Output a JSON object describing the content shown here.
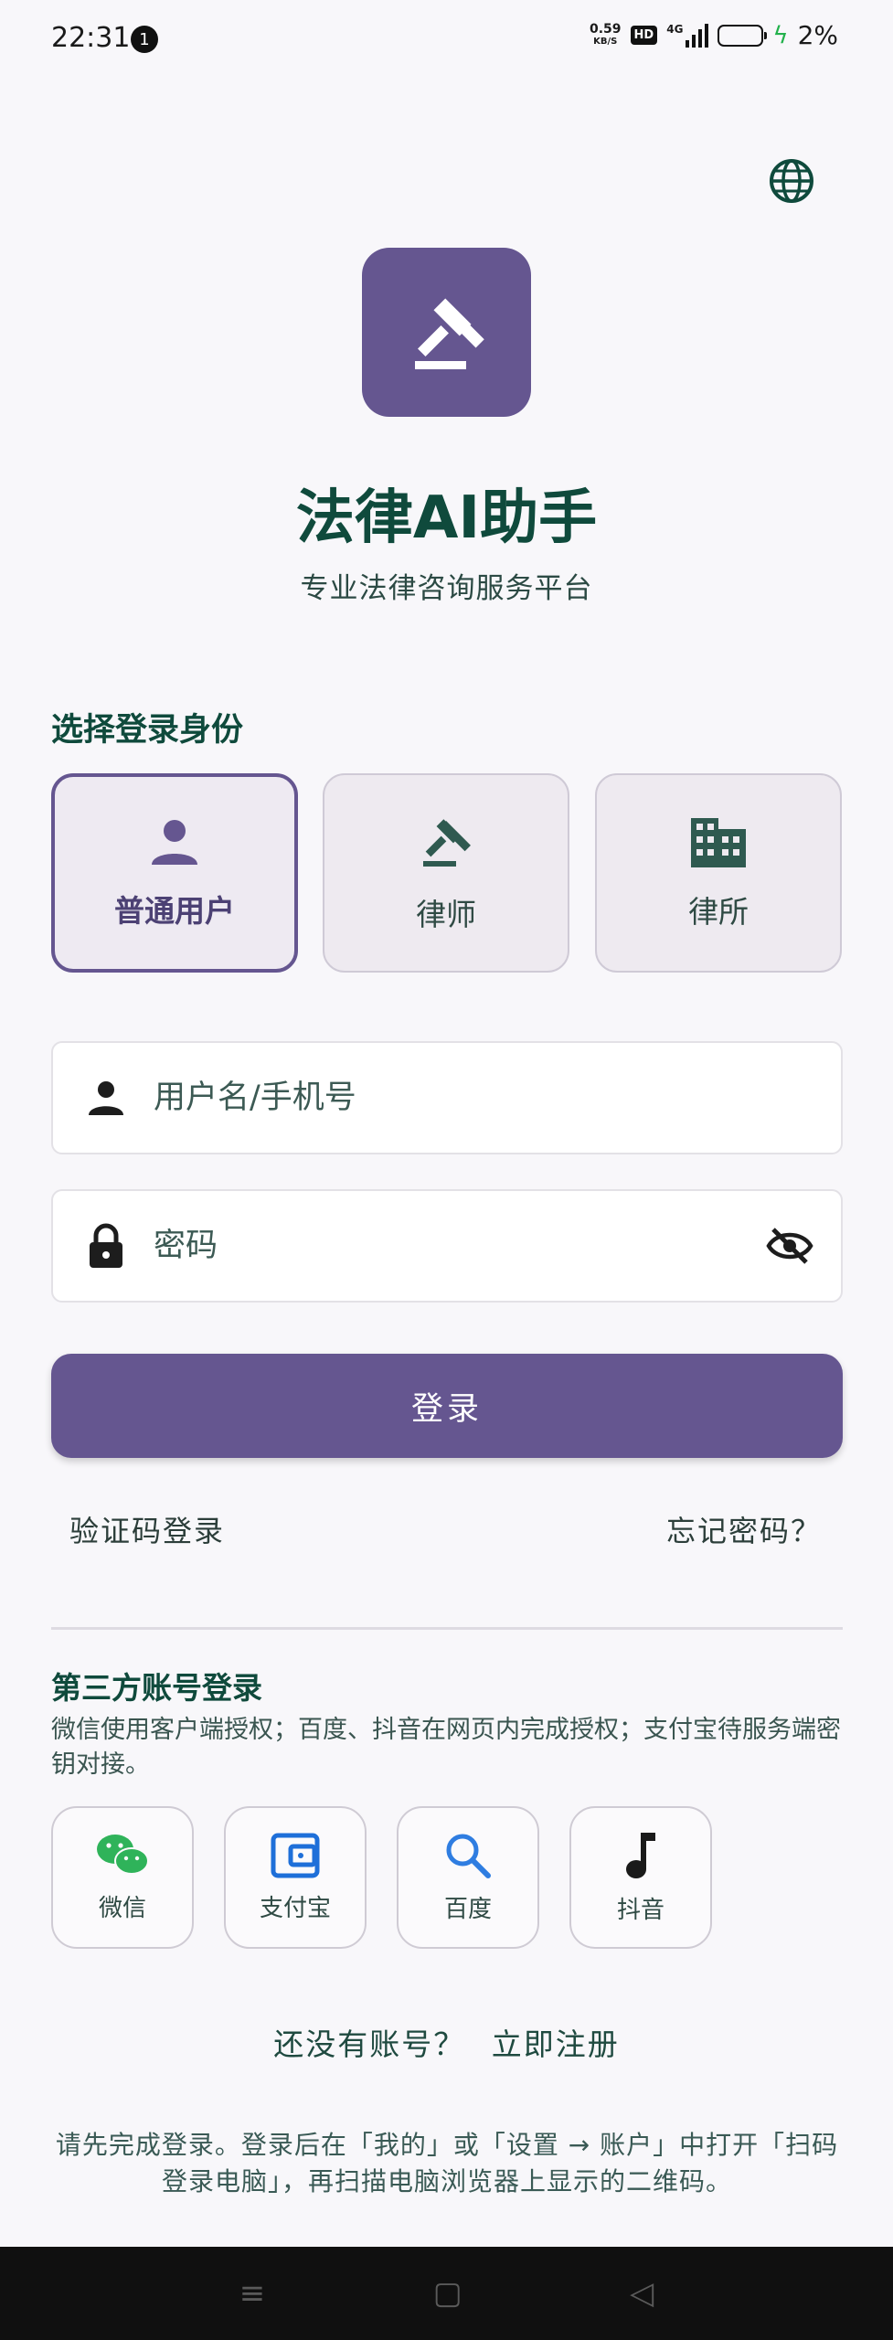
{
  "status_bar": {
    "time": "22:31",
    "notification_count": "1",
    "net_speed_value": "0.59",
    "net_speed_unit": "KB/S",
    "hd_label": "HD",
    "network_label": "4G",
    "battery_percent": "2%"
  },
  "app": {
    "title": "法律AI助手",
    "subtitle": "专业法律咨询服务平台",
    "accent_color": "#655690",
    "title_color": "#0f4a3c"
  },
  "role_section": {
    "label": "选择登录身份",
    "roles": [
      {
        "label": "普通用户",
        "icon": "person-icon",
        "selected": true
      },
      {
        "label": "律师",
        "icon": "gavel-icon",
        "selected": false
      },
      {
        "label": "律所",
        "icon": "building-icon",
        "selected": false
      }
    ]
  },
  "form": {
    "username_placeholder": "用户名/手机号",
    "password_placeholder": "密码",
    "login_label": "登录",
    "sms_login_label": "验证码登录",
    "forgot_label": "忘记密码？"
  },
  "third_party": {
    "title": "第三方账号登录",
    "description": "微信使用客户端授权；百度、抖音在网页内完成授权；支付宝待服务端密钥对接。",
    "providers": [
      {
        "label": "微信",
        "icon": "wechat-icon"
      },
      {
        "label": "支付宝",
        "icon": "alipay-icon"
      },
      {
        "label": "百度",
        "icon": "search-icon"
      },
      {
        "label": "抖音",
        "icon": "music-note-icon"
      }
    ]
  },
  "register": {
    "prompt": "还没有账号？",
    "link": "立即注册"
  },
  "footer_hint": "请先完成登录。登录后在「我的」或「设置 → 账户」中打开「扫码登录电脑」，再扫描电脑浏览器上显示的二维码。",
  "nav_bar": {
    "menu_icon": "≡",
    "home_icon": "▢",
    "back_icon": "◁"
  }
}
